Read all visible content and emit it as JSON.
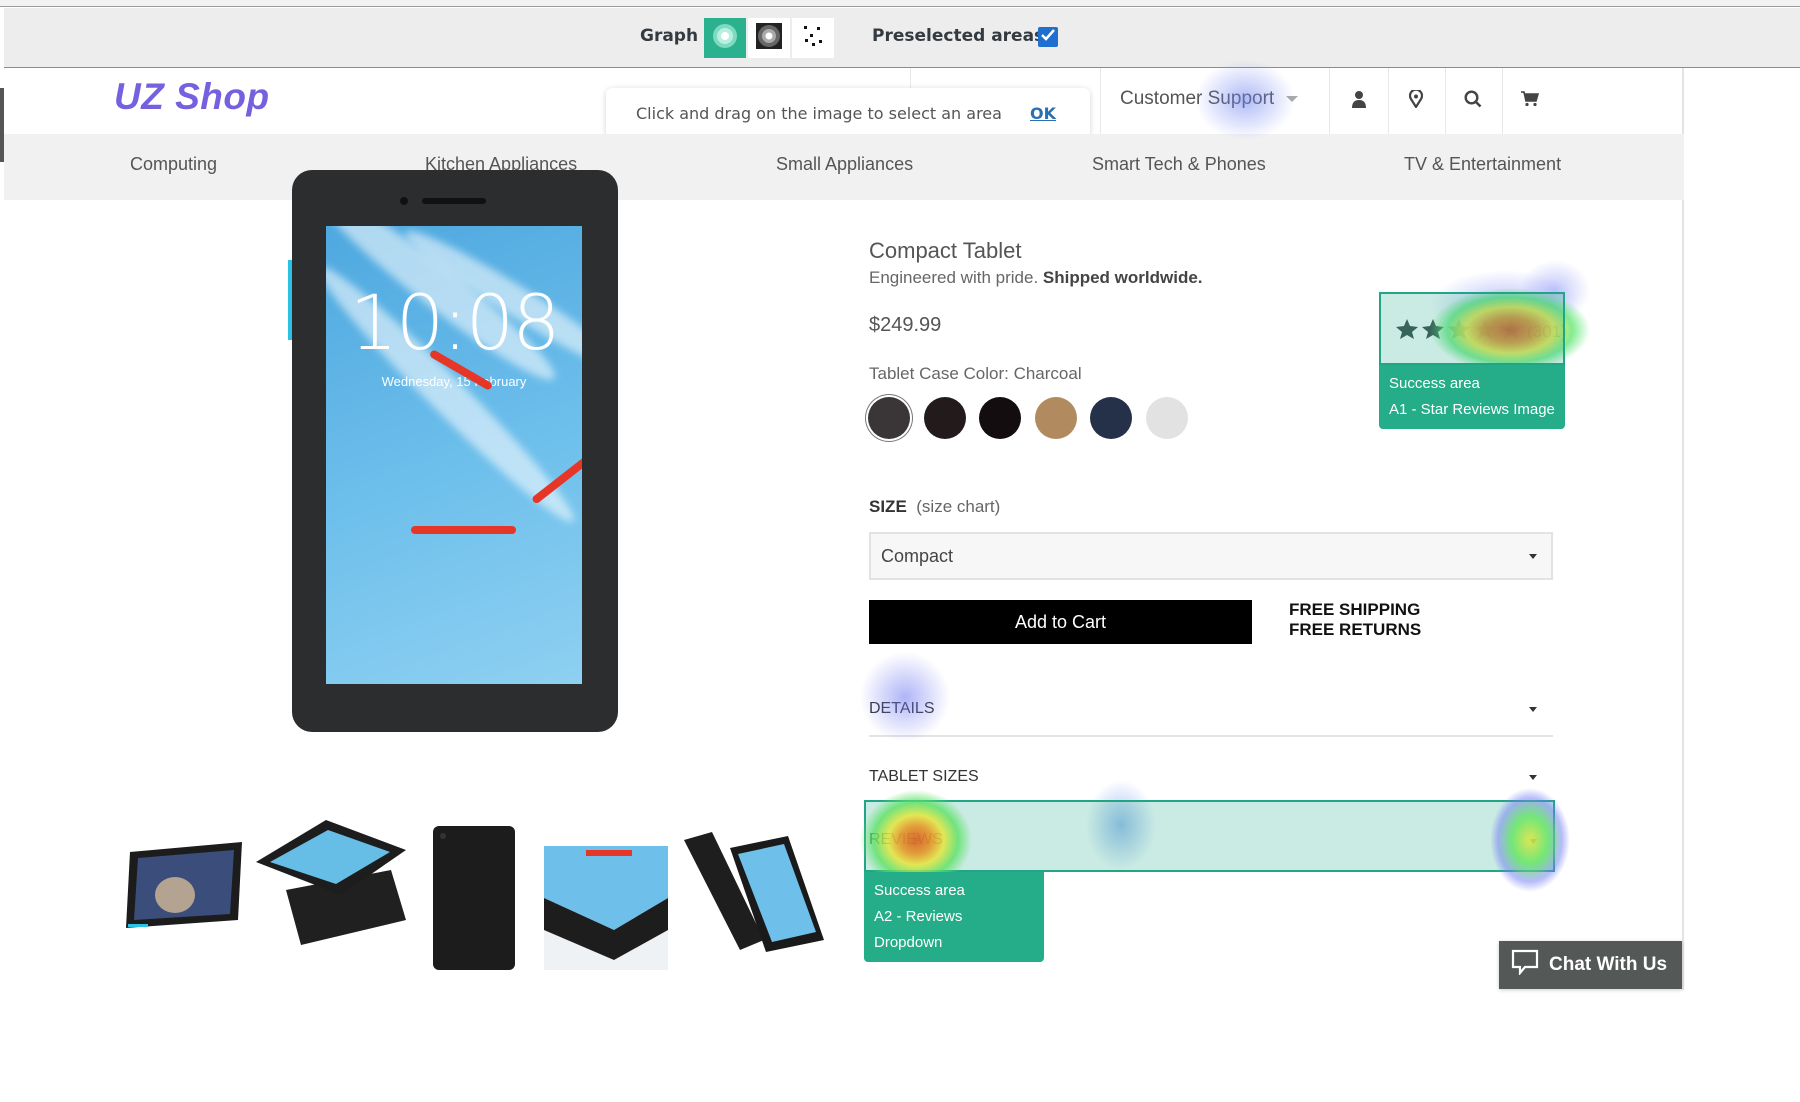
{
  "toolbar": {
    "graph_label": "Graph",
    "graph_modes": [
      {
        "name": "heatmap",
        "active": true
      },
      {
        "name": "attention",
        "active": false
      },
      {
        "name": "scatter",
        "active": false
      }
    ],
    "preselected_label": "Preselected areas",
    "preselected_checked": true
  },
  "hint": {
    "text": "Click and drag on the image to select an area",
    "ok_label": "OK"
  },
  "header": {
    "logo": "UZ Shop",
    "support_label": "Customer Support",
    "icons": [
      "user-icon",
      "location-pin-icon",
      "search-icon",
      "cart-icon"
    ]
  },
  "nav": {
    "items": [
      "Computing",
      "Kitchen Appliances",
      "Small Appliances",
      "Smart Tech & Phones",
      "TV & Entertainment"
    ]
  },
  "product": {
    "screen_time": "10:08",
    "screen_date": "Wednesday, 15 February",
    "title": "Compact Tablet",
    "subtitle_plain": "Engineered with pride. ",
    "subtitle_bold": "Shipped worldwide.",
    "price": "$249.99",
    "rating_count": "(301)",
    "rating_stars": 2.5,
    "color_label": "Tablet Case Color: Charcoal",
    "swatches": [
      {
        "name": "Charcoal",
        "color": "#3a3637",
        "selected": true
      },
      {
        "name": "Espresso",
        "color": "#231b1b",
        "selected": false
      },
      {
        "name": "Black",
        "color": "#140d0f",
        "selected": false
      },
      {
        "name": "Tan",
        "color": "#b18a5f",
        "selected": false
      },
      {
        "name": "Navy",
        "color": "#253149",
        "selected": false
      },
      {
        "name": "Light Grey",
        "color": "#e2e2e2",
        "selected": false
      }
    ],
    "size_label": "SIZE",
    "size_chart_label": "(size chart)",
    "size_value": "Compact",
    "add_to_cart": "Add to Cart",
    "free_shipping": "FREE SHIPPING",
    "free_returns": "FREE RETURNS",
    "accordions": [
      "DETAILS",
      "TABLET SIZES",
      "REVIEWS"
    ],
    "thumbnail_count": 5
  },
  "areas": [
    {
      "title": "Success area",
      "label": "A1 - Star Reviews Image"
    },
    {
      "title": "Success area",
      "label": "A2 - Reviews Dropdown"
    }
  ],
  "chat": {
    "label": "Chat With Us"
  },
  "colors": {
    "accent": "#2bb18e",
    "logo": "#7561e0",
    "link": "#2b6fb3",
    "checkbox": "#1e6fd0"
  }
}
